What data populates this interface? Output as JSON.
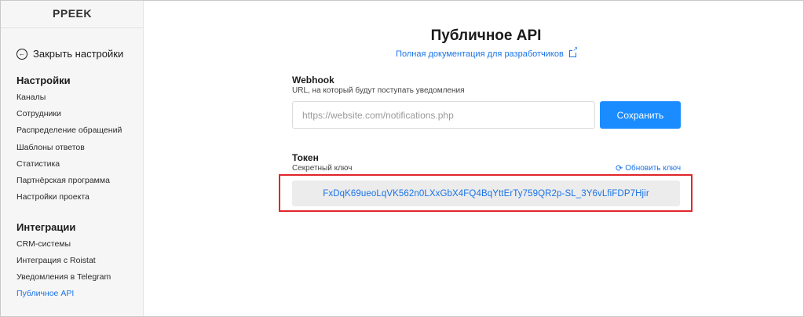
{
  "sidebar": {
    "logo": "PPEEK",
    "close_settings": "Закрыть настройки",
    "sections": [
      {
        "title": "Настройки",
        "items": [
          "Каналы",
          "Сотрудники",
          "Распределение обращений",
          "Шаблоны ответов",
          "Статистика",
          "Партнёрская программа",
          "Настройки проекта"
        ]
      },
      {
        "title": "Интеграции",
        "items": [
          "CRM-системы",
          "Интеграция с Roistat",
          "Уведомления в Telegram",
          "Публичное API"
        ]
      }
    ],
    "active_item": "Публичное API"
  },
  "main": {
    "title": "Публичное API",
    "doc_link": "Полная документация для разработчиков",
    "webhook": {
      "label": "Webhook",
      "description": "URL, на который будут поступать уведомления",
      "placeholder": "https://website.com/notifications.php",
      "value": "",
      "save_label": "Сохранить"
    },
    "token": {
      "label": "Токен",
      "description": "Секретный ключ",
      "refresh_label": "Обновить ключ",
      "value": "FxDqK69ueoLqVK562n0LXxGbX4FQ4BqYttErTy759QR2p-SL_3Y6vLfiFDP7Hjir"
    }
  },
  "colors": {
    "accent": "#1a73e8",
    "button": "#1a8cff",
    "highlight": "#e0262b",
    "sidebar_bg": "#f6f6f6"
  },
  "icons": [
    "back-arrow-icon",
    "external-link-icon",
    "refresh-icon"
  ]
}
